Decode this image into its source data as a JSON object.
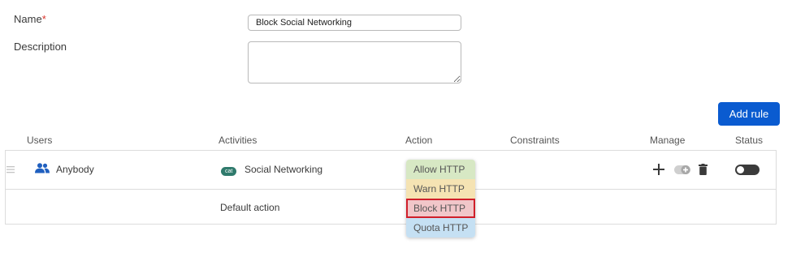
{
  "form": {
    "name_label": "Name",
    "name_required_marker": "*",
    "name_value": "Block Social Networking",
    "description_label": "Description",
    "description_value": ""
  },
  "add_rule_label": "Add rule",
  "columns": {
    "users": "Users",
    "activities": "Activities",
    "action": "Action",
    "constraints": "Constraints",
    "manage": "Manage",
    "status": "Status"
  },
  "rule_row": {
    "user_icon": "users-group-icon",
    "user": "Anybody",
    "activity_badge": "cat",
    "activity": "Social Networking",
    "status_on": false
  },
  "default_row": {
    "label": "Default action"
  },
  "action_dropdown": {
    "options": [
      {
        "label": "Allow HTTP",
        "color": "#d7e8c4"
      },
      {
        "label": "Warn HTTP",
        "color": "#f5e3b3"
      },
      {
        "label": "Block HTTP",
        "color": "#f1c6c9",
        "highlighted": true,
        "highlight_border": "#d01f2a"
      },
      {
        "label": "Quota HTTP",
        "color": "#c5e0f3"
      }
    ]
  },
  "icons": {
    "drag_handle": "drag-handle-icon",
    "add": "plus-icon",
    "add_constraint": "add-toggle-icon",
    "delete": "trash-icon"
  },
  "colors": {
    "primary": "#0a5bd0",
    "user_icon": "#1f5fbf",
    "badge": "#2f7a6c"
  }
}
